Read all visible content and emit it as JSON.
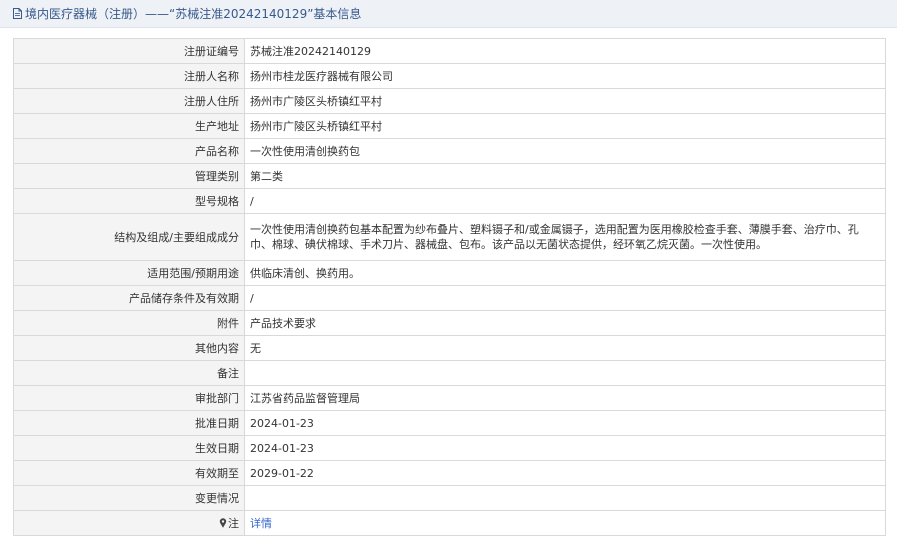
{
  "header": {
    "title": "境内医疗器械（注册）——“苏械注准20242140129”基本信息",
    "icon": "document-icon",
    "color": "#37598c"
  },
  "rows": [
    {
      "label": "注册证编号",
      "value": "苏械注准20242140129"
    },
    {
      "label": "注册人名称",
      "value": "扬州市桂龙医疗器械有限公司"
    },
    {
      "label": "注册人住所",
      "value": "扬州市广陵区头桥镇红平村"
    },
    {
      "label": "生产地址",
      "value": "扬州市广陵区头桥镇红平村"
    },
    {
      "label": "产品名称",
      "value": "一次性使用清创换药包"
    },
    {
      "label": "管理类别",
      "value": "第二类"
    },
    {
      "label": "型号规格",
      "value": "/"
    },
    {
      "label": "结构及组成/主要组成成分",
      "value": "一次性使用清创换药包基本配置为纱布叠片、塑料镊子和/或金属镊子，选用配置为医用橡胶检查手套、薄膜手套、治疗巾、孔巾、棉球、碘伏棉球、手术刀片、器械盘、包布。该产品以无菌状态提供，经环氧乙烷灭菌。一次性使用。"
    },
    {
      "label": "适用范围/预期用途",
      "value": "供临床清创、换药用。"
    },
    {
      "label": "产品储存条件及有效期",
      "value": "/"
    },
    {
      "label": "附件",
      "value": "产品技术要求"
    },
    {
      "label": "其他内容",
      "value": "无"
    },
    {
      "label": "备注",
      "value": ""
    },
    {
      "label": "审批部门",
      "value": "江苏省药品监督管理局"
    },
    {
      "label": "批准日期",
      "value": "2024-01-23"
    },
    {
      "label": "生效日期",
      "value": "2024-01-23"
    },
    {
      "label": "有效期至",
      "value": "2029-01-22"
    },
    {
      "label": "变更情况",
      "value": ""
    }
  ],
  "note_row": {
    "label": "注",
    "icon": "pin-icon",
    "link_text": "详情",
    "link_color": "#3366cc"
  }
}
